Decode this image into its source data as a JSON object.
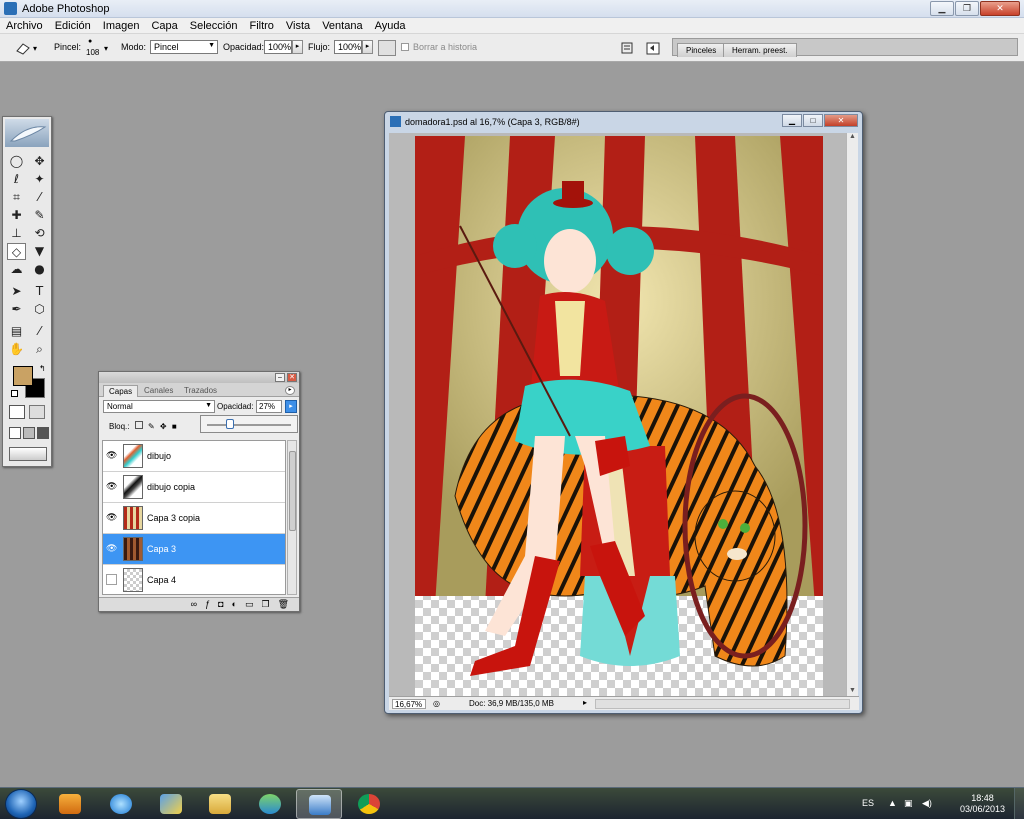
{
  "window": {
    "title": "Adobe Photoshop"
  },
  "menu": [
    "Archivo",
    "Edición",
    "Imagen",
    "Capa",
    "Selección",
    "Filtro",
    "Vista",
    "Ventana",
    "Ayuda"
  ],
  "options": {
    "brush_label": "Pincel:",
    "brush_size": "108",
    "mode_label": "Modo:",
    "mode_value": "Pincel",
    "opacity_label": "Opacidad:",
    "opacity_value": "100%",
    "flow_label": "Flujo:",
    "flow_value": "100%",
    "erase_history": "Borrar a historia"
  },
  "palette_well": {
    "tab1": "Pinceles",
    "tab2": "Herram. preest."
  },
  "layers_panel": {
    "tabs": [
      "Capas",
      "Canales",
      "Trazados"
    ],
    "blend_mode": "Normal",
    "opacity_label": "Opacidad:",
    "opacity_value": "27%",
    "lock_label": "Bloq.:",
    "layers": [
      {
        "name": "dibujo",
        "visible": true,
        "selected": false
      },
      {
        "name": "dibujo copia",
        "visible": true,
        "selected": false
      },
      {
        "name": "Capa 3 copia",
        "visible": true,
        "selected": false
      },
      {
        "name": "Capa 3",
        "visible": true,
        "selected": true
      },
      {
        "name": "Capa 4",
        "visible": false,
        "selected": false
      }
    ]
  },
  "document": {
    "title": "domadora1.psd al 16,7% (Capa 3, RGB/8#)",
    "zoom": "16,67%",
    "doc_info": "Doc: 36,9 MB/135,0 MB"
  },
  "taskbar": {
    "lang": "ES",
    "time": "18:48",
    "date": "03/06/2013"
  },
  "colors": {
    "foreground": "#c9a264",
    "background": "#000000",
    "selection": "#3d95f3"
  }
}
